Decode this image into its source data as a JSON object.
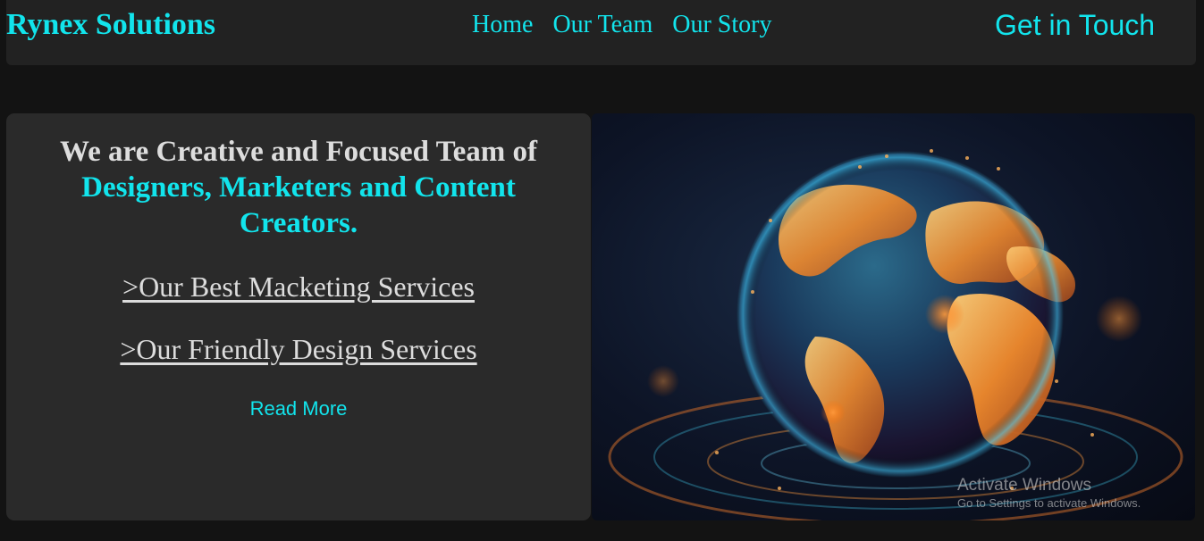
{
  "header": {
    "brand": "Rynex Solutions",
    "nav": [
      "Home",
      "Our Team",
      "Our Story"
    ],
    "cta": "Get in Touch"
  },
  "hero": {
    "headline_plain": "We are Creative and Focused Team of",
    "headline_accent": "Designers, Marketers and Content Creators.",
    "service_links": [
      ">Our Best Macketing Services",
      ">Our Friendly Design Services"
    ],
    "read_more": "Read More",
    "image": "globe-network-illustration"
  },
  "os_watermark": {
    "title": "Activate Windows",
    "subtitle": "Go to Settings to activate Windows."
  },
  "colors": {
    "page_background": "#131313",
    "navbar_background": "#222222",
    "card_background": "#2a2a2a",
    "accent": "#12e4ec",
    "text_light": "#dddddd"
  }
}
